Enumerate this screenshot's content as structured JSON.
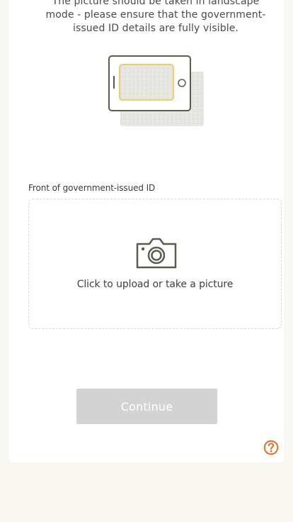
{
  "instructions": {
    "text": "The picture should be taken in landscape\nmode - please ensure that the government-\nissued ID details are fully visible."
  },
  "illustration": {
    "icon": "landscape-phone-id-icon"
  },
  "upload": {
    "label": "Front of government-issued ID",
    "prompt": "Click to upload or take a picture",
    "icon": "camera-icon"
  },
  "actions": {
    "continue_label": "Continue",
    "continue_enabled": false
  },
  "help": {
    "icon": "question-circle-icon",
    "color": "#e86b1f"
  },
  "colors": {
    "page_background": "#f9f7f2",
    "card_background": "#ffffff",
    "accent_gold": "#f0cc6b",
    "icon_dark": "#5a5d4c",
    "button_disabled": "#d3d3d3"
  }
}
